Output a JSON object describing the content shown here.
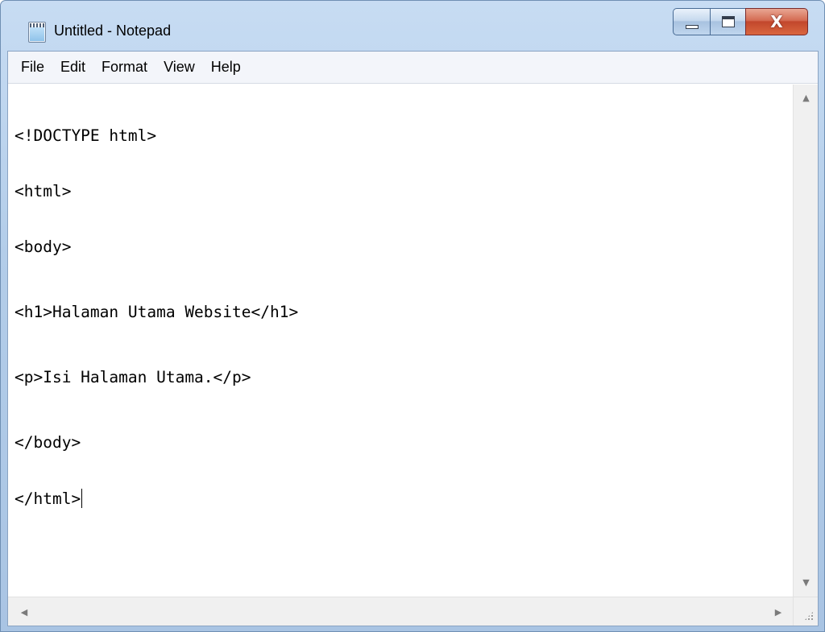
{
  "window": {
    "title": "Untitled - Notepad",
    "controls": {
      "minimize_icon": "minimize-icon",
      "maximize_icon": "maximize-icon",
      "close_label": "X"
    }
  },
  "menu": [
    "File",
    "Edit",
    "Format",
    "View",
    "Help"
  ],
  "editor": {
    "lines": [
      "<!DOCTYPE html>",
      "<html>",
      "<body>",
      "<h1>Halaman Utama Website</h1>",
      "<p>Isi Halaman Utama.</p>",
      "</body>",
      "</html>"
    ]
  },
  "scrollbars": {
    "up_arrow": "▲",
    "down_arrow": "▼",
    "left_arrow": "◀",
    "right_arrow": "▶"
  },
  "colors": {
    "frame": "#b3cde9",
    "close_button": "#c2472c",
    "editor_bg": "#ffffff"
  }
}
